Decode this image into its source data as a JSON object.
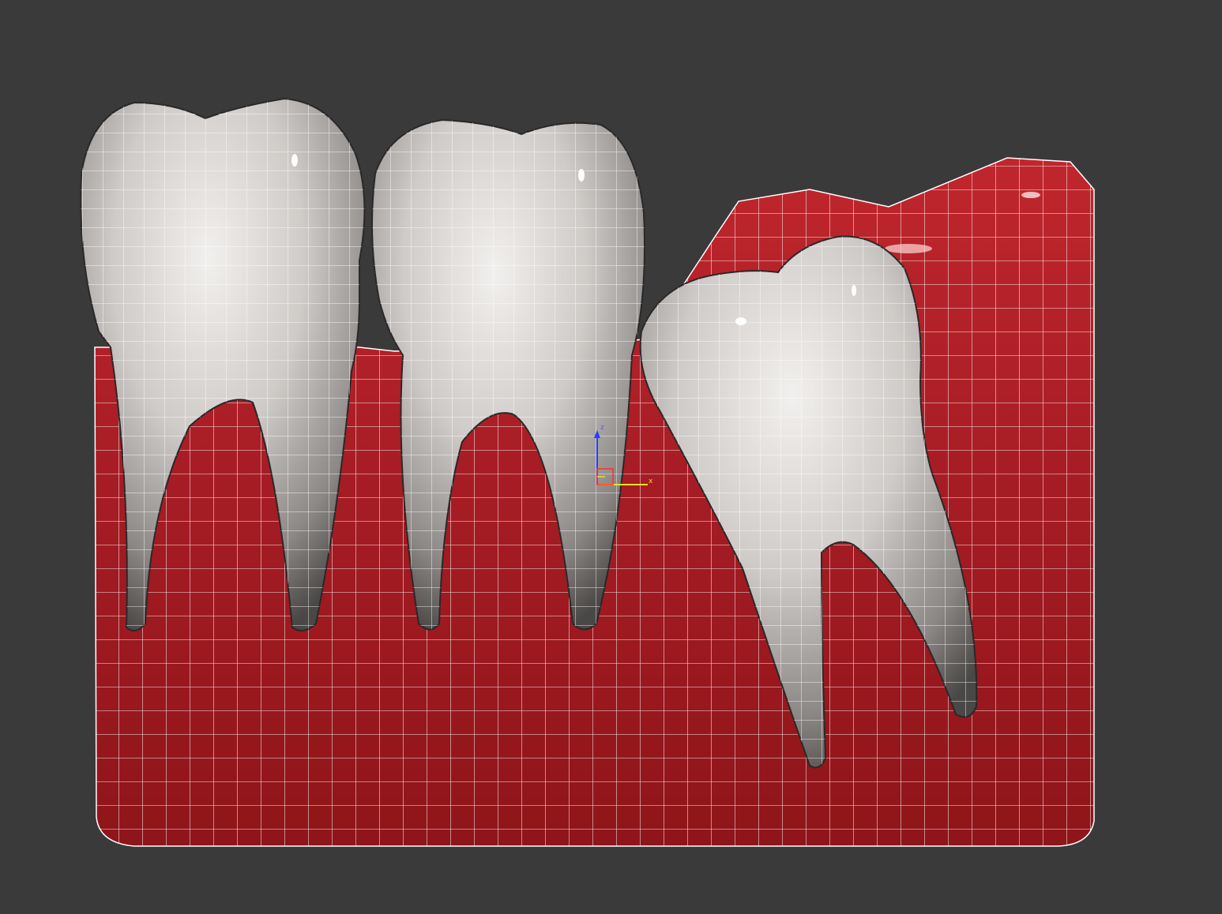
{
  "viewport": {
    "background": "#3a3a3a",
    "gum_color": "#a81c25",
    "gum_highlight": "#d43a40",
    "tooth_color": "#c9c5c2",
    "tooth_highlight": "#f4f2f0",
    "tooth_shadow": "#5a5755",
    "wire_color": "#ffffff"
  },
  "gizmo": {
    "z_label": "z",
    "x_label": "x",
    "z_color": "#2a3cff",
    "x_color": "#ff3030",
    "y_color": "#e8e020"
  }
}
